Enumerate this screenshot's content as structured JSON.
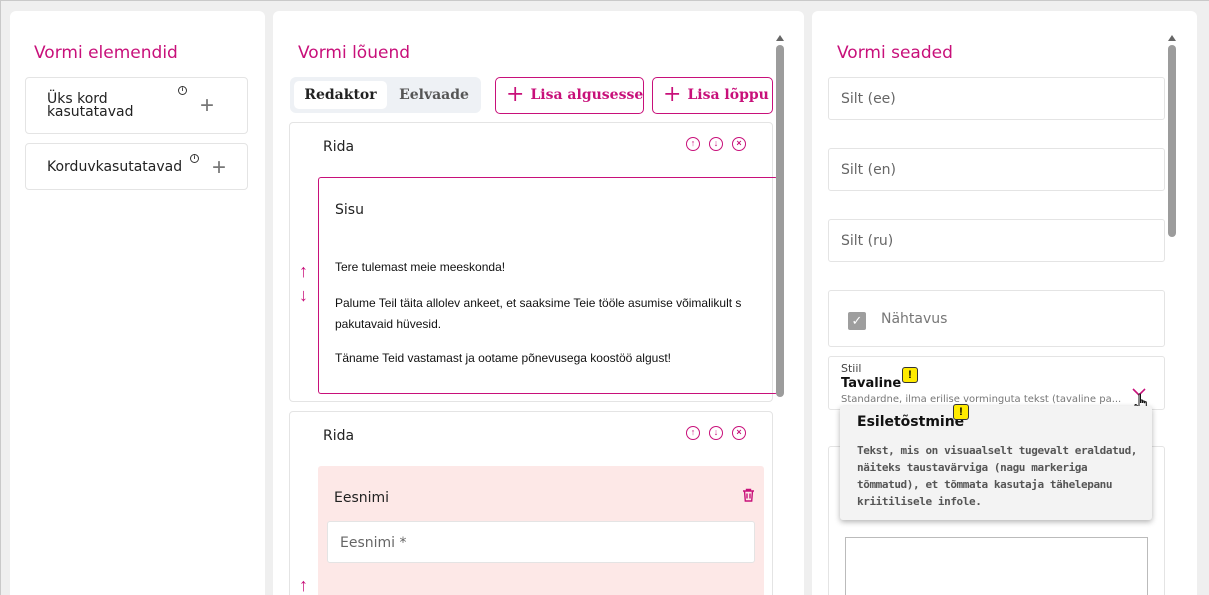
{
  "left_panel": {
    "title": "Vormi elemendid",
    "items": [
      {
        "label": "Üks kord\nkasutatavad"
      },
      {
        "label": "Korduvkasutatavad"
      }
    ]
  },
  "canvas_panel": {
    "title": "Vormi lõuend",
    "tabs": [
      {
        "label": "Redaktor",
        "active": true
      },
      {
        "label": "Eelvaade",
        "active": false
      }
    ],
    "add_start_label": "Lisa algusesse",
    "add_end_label": "Lisa lõppu",
    "rows": [
      {
        "title": "Rida",
        "content_title": "Sisu",
        "lines": [
          "Tere tulemast meie meeskonda!",
          "Palume Teil täita allolev ankeet, et saaksime Teie tööle asumise võimalikult s",
          "pakutavaid hüvesid.",
          "Täname Teid vastamast ja ootame põnevusega koostöö algust!"
        ]
      },
      {
        "title": "Rida",
        "field_title": "Eesnimi",
        "field_placeholder": "Eesnimi *"
      }
    ]
  },
  "settings_panel": {
    "title": "Vormi seaded",
    "fields": [
      {
        "placeholder": "Silt (ee)"
      },
      {
        "placeholder": "Silt (en)"
      },
      {
        "placeholder": "Silt (ru)"
      }
    ],
    "visibility_label": "Nähtavus",
    "style": {
      "label": "Stiil",
      "value": "Tavaline",
      "description": "Standardne, ilma erilise vorminguta tekst (tavaline pa..."
    }
  },
  "tooltip": {
    "title": "Esiletõstmine",
    "body": "Tekst, mis on visuaalselt tugevalt eraldatud, näiteks taustavärviga (nagu markeriga tõmmatud), et tõmmata kasutaja tähelepanu kriitilisele infole."
  },
  "colors": {
    "accent": "#c8107a",
    "warning": "#ffeb00",
    "field_bg": "#fde8e7"
  }
}
